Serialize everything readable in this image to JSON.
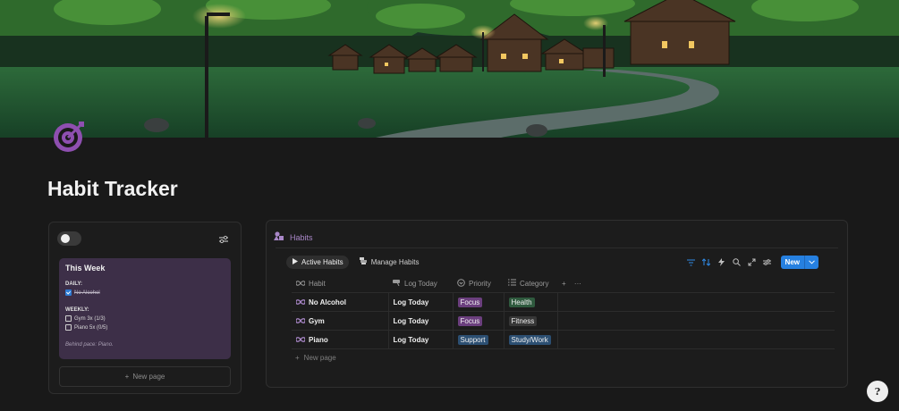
{
  "page": {
    "title": "Habit Tracker",
    "icon": "target-icon"
  },
  "cover": {
    "description_icon": "village-night-illustration"
  },
  "sidebar_card": {
    "toggle_icon": "toggle-icon",
    "settings_icon": "settings-sliders-icon",
    "title": "This Week",
    "daily_label": "DAILY:",
    "daily_items": [
      {
        "text": "No Alcohol",
        "checked": true
      }
    ],
    "weekly_label": "WEEKLY:",
    "weekly_items": [
      {
        "text": "Gym 3x (1/3)",
        "checked": false
      },
      {
        "text": "Piano 5x (0/5)",
        "checked": false
      }
    ],
    "note": "Behind pace: Piano.",
    "new_page_label": "New page"
  },
  "database": {
    "title": "Habits",
    "tabs": [
      {
        "label": "Active Habits",
        "active": true,
        "icon": "play-icon"
      },
      {
        "label": "Manage Habits",
        "active": false,
        "icon": "list-icon"
      }
    ],
    "new_label": "New",
    "columns": [
      {
        "label": "Habit",
        "icon": "infinity-icon"
      },
      {
        "label": "Log Today",
        "icon": "button-icon"
      },
      {
        "label": "Priority",
        "icon": "select-icon"
      },
      {
        "label": "Category",
        "icon": "list-icon"
      }
    ],
    "rows": [
      {
        "habit": "No Alcohol",
        "log": "Log Today",
        "priority": "Focus",
        "priority_color": "#6b3f7e",
        "category": "Health",
        "category_color": "#2f5a3e"
      },
      {
        "habit": "Gym",
        "log": "Log Today",
        "priority": "Focus",
        "priority_color": "#6b3f7e",
        "category": "Fitness",
        "category_color": "#373737"
      },
      {
        "habit": "Piano",
        "log": "Log Today",
        "priority": "Support",
        "priority_color": "#2c4f72",
        "category": "Study/Work",
        "category_color": "#2c4f72"
      }
    ],
    "new_row_label": "New page"
  },
  "help_button": {
    "label": "?"
  },
  "colors": {
    "accent": "#2680e0",
    "database_title": "#a987c8",
    "card_bg": "#3d2f48"
  }
}
